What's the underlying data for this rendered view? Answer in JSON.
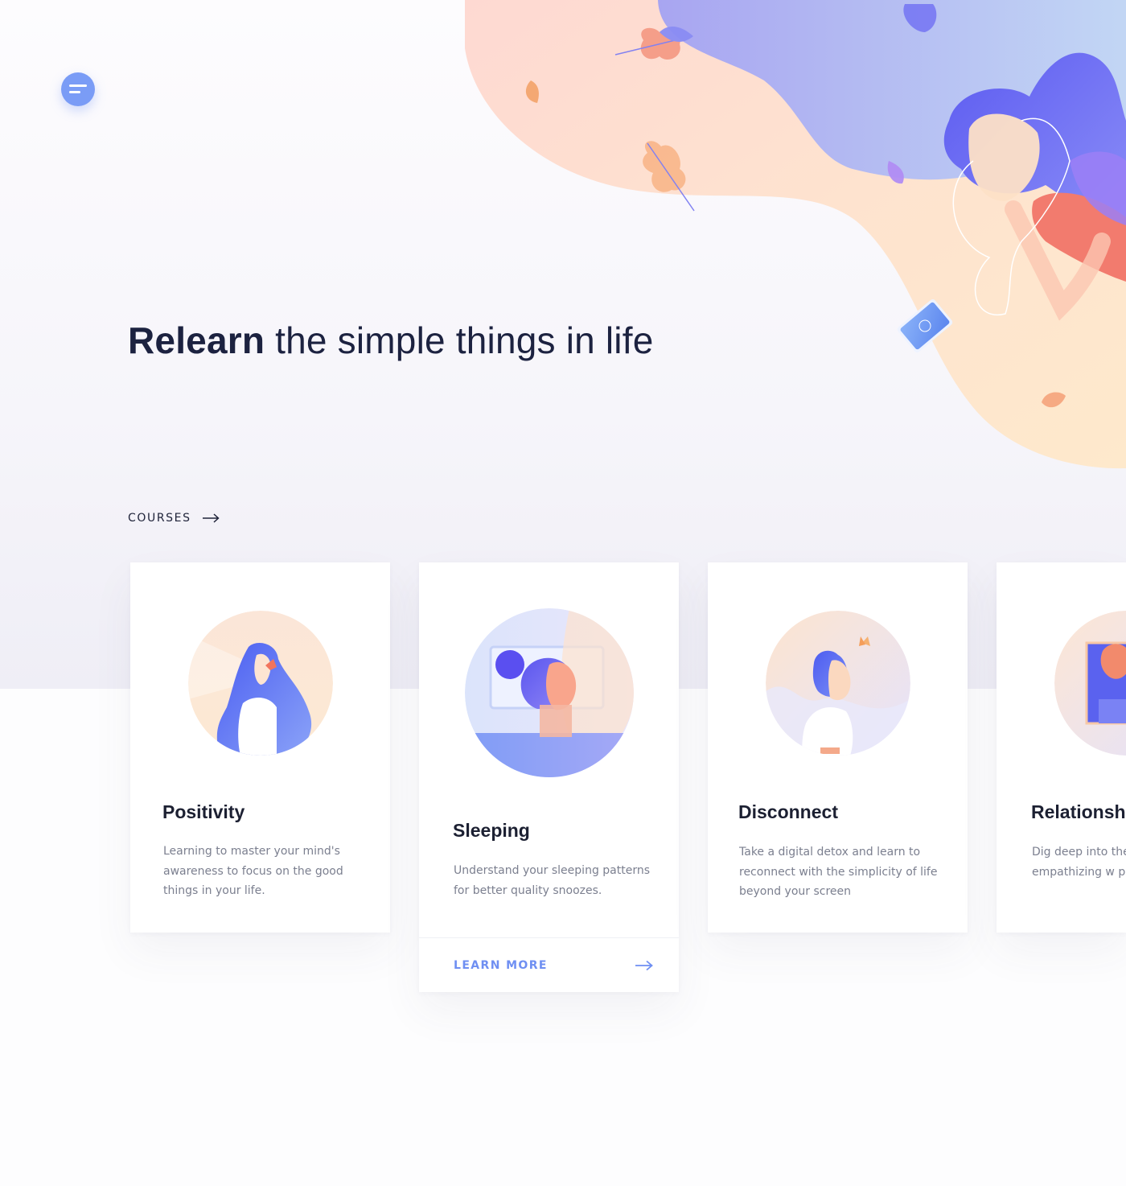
{
  "hero": {
    "title_bold": "Relearn",
    "title_rest": " the simple things in life"
  },
  "nav": {
    "menu_icon": "menu-icon",
    "courses_label": "COURSES",
    "courses_icon": "arrow-right-icon"
  },
  "colors": {
    "accent": "#7a9cf6",
    "heading": "#1c2240",
    "body_text": "#7b7f8f",
    "link": "#6f8ff2"
  },
  "cards": [
    {
      "title": "Positivity",
      "description": "Learning to master your mind's awareness to focus on the good things in your life.",
      "icon": "woman-with-flower-illustration"
    },
    {
      "title": "Sleeping",
      "description": "Understand your sleeping patterns for better quality snoozes.",
      "icon": "sleeping-woman-illustration",
      "cta_label": "LEARN MORE",
      "cta_icon": "arrow-right-icon"
    },
    {
      "title": "Disconnect",
      "description": "Take a digital detox and learn to reconnect with the simplicity of life beyond your screen",
      "icon": "man-with-butterfly-illustration"
    },
    {
      "title": "Relationsh",
      "description": "Dig deep into the to empathizing w partner.",
      "icon": "couple-illustration"
    }
  ]
}
